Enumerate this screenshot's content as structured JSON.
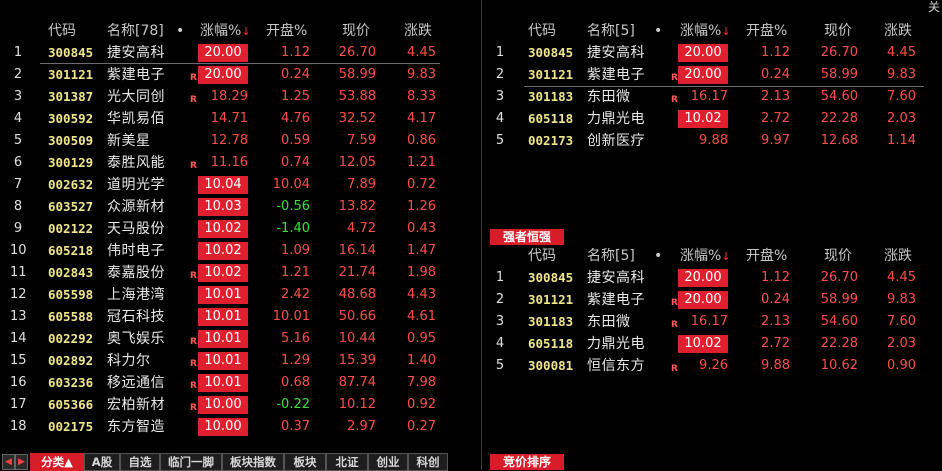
{
  "header": {
    "code": "代码",
    "name_left": "名称[78]",
    "name_right": "名称[5]",
    "dot": "•",
    "change": "涨幅%",
    "sort_arrow": "↓",
    "open": "开盘%",
    "price": "现价",
    "rise": "涨跌"
  },
  "close_label": "关闭",
  "right_top_label": "强者恒强",
  "right_bottom_label": "竞价排序",
  "colors": {
    "accent_red": "#d81c28",
    "code_yellow": "#f0e68c",
    "up_red": "#ff4d4d",
    "down_green": "#3ce03c"
  },
  "left_rows": [
    {
      "idx": "1",
      "code": "300845",
      "name": "捷安高科",
      "r": "",
      "change": "20.00",
      "boxed": true,
      "open": "1.12",
      "open_color": "red",
      "price": "26.70",
      "rise": "4.45"
    },
    {
      "idx": "2",
      "code": "301121",
      "name": "紫建电子",
      "r": "R",
      "change": "20.00",
      "boxed": true,
      "open": "0.24",
      "open_color": "red",
      "price": "58.99",
      "rise": "9.83"
    },
    {
      "idx": "3",
      "code": "301387",
      "name": "光大同创",
      "r": "R",
      "change": "18.29",
      "boxed": false,
      "open": "1.25",
      "open_color": "red",
      "price": "53.88",
      "rise": "8.33"
    },
    {
      "idx": "4",
      "code": "300592",
      "name": "华凯易佰",
      "r": "",
      "change": "14.71",
      "boxed": false,
      "open": "4.76",
      "open_color": "red",
      "price": "32.52",
      "rise": "4.17"
    },
    {
      "idx": "5",
      "code": "300509",
      "name": "新美星",
      "r": "",
      "change": "12.78",
      "boxed": false,
      "open": "0.59",
      "open_color": "red",
      "price": "7.59",
      "rise": "0.86"
    },
    {
      "idx": "6",
      "code": "300129",
      "name": "泰胜风能",
      "r": "R",
      "change": "11.16",
      "boxed": false,
      "open": "0.74",
      "open_color": "red",
      "price": "12.05",
      "rise": "1.21"
    },
    {
      "idx": "7",
      "code": "002632",
      "name": "道明光学",
      "r": "",
      "change": "10.04",
      "boxed": true,
      "open": "10.04",
      "open_color": "red",
      "price": "7.89",
      "rise": "0.72"
    },
    {
      "idx": "8",
      "code": "603527",
      "name": "众源新材",
      "r": "",
      "change": "10.03",
      "boxed": true,
      "open": "-0.56",
      "open_color": "green",
      "price": "13.82",
      "rise": "1.26"
    },
    {
      "idx": "9",
      "code": "002122",
      "name": "天马股份",
      "r": "",
      "change": "10.02",
      "boxed": true,
      "open": "-1.40",
      "open_color": "green",
      "price": "4.72",
      "rise": "0.43"
    },
    {
      "idx": "10",
      "code": "605218",
      "name": "伟时电子",
      "r": "",
      "change": "10.02",
      "boxed": true,
      "open": "1.09",
      "open_color": "red",
      "price": "16.14",
      "rise": "1.47"
    },
    {
      "idx": "11",
      "code": "002843",
      "name": "泰嘉股份",
      "r": "R",
      "change": "10.02",
      "boxed": true,
      "open": "1.21",
      "open_color": "red",
      "price": "21.74",
      "rise": "1.98"
    },
    {
      "idx": "12",
      "code": "605598",
      "name": "上海港湾",
      "r": "",
      "change": "10.01",
      "boxed": true,
      "open": "2.42",
      "open_color": "red",
      "price": "48.68",
      "rise": "4.43"
    },
    {
      "idx": "13",
      "code": "605588",
      "name": "冠石科技",
      "r": "",
      "change": "10.01",
      "boxed": true,
      "open": "10.01",
      "open_color": "red",
      "price": "50.66",
      "rise": "4.61"
    },
    {
      "idx": "14",
      "code": "002292",
      "name": "奥飞娱乐",
      "r": "R",
      "change": "10.01",
      "boxed": true,
      "open": "5.16",
      "open_color": "red",
      "price": "10.44",
      "rise": "0.95"
    },
    {
      "idx": "15",
      "code": "002892",
      "name": "科力尔",
      "r": "R",
      "change": "10.01",
      "boxed": true,
      "open": "1.29",
      "open_color": "red",
      "price": "15.39",
      "rise": "1.40"
    },
    {
      "idx": "16",
      "code": "603236",
      "name": "移远通信",
      "r": "R",
      "change": "10.01",
      "boxed": true,
      "open": "0.68",
      "open_color": "red",
      "price": "87.74",
      "rise": "7.98"
    },
    {
      "idx": "17",
      "code": "605366",
      "name": "宏柏新材",
      "r": "R",
      "change": "10.00",
      "boxed": true,
      "open": "-0.22",
      "open_color": "green",
      "price": "10.12",
      "rise": "0.92"
    },
    {
      "idx": "18",
      "code": "002175",
      "name": "东方智造",
      "r": "",
      "change": "10.00",
      "boxed": true,
      "open": "0.37",
      "open_color": "red",
      "price": "2.97",
      "rise": "0.27"
    }
  ],
  "right_top_rows": [
    {
      "idx": "1",
      "code": "300845",
      "name": "捷安高科",
      "r": "",
      "change": "20.00",
      "boxed": true,
      "open": "1.12",
      "open_color": "red",
      "price": "26.70",
      "rise": "4.45"
    },
    {
      "idx": "2",
      "code": "301121",
      "name": "紫建电子",
      "r": "R",
      "change": "20.00",
      "boxed": true,
      "open": "0.24",
      "open_color": "red",
      "price": "58.99",
      "rise": "9.83"
    },
    {
      "idx": "3",
      "code": "301183",
      "name": "东田微",
      "r": "R",
      "change": "16.17",
      "boxed": false,
      "open": "2.13",
      "open_color": "red",
      "price": "54.60",
      "rise": "7.60"
    },
    {
      "idx": "4",
      "code": "605118",
      "name": "力鼎光电",
      "r": "",
      "change": "10.02",
      "boxed": true,
      "open": "2.72",
      "open_color": "red",
      "price": "22.28",
      "rise": "2.03"
    },
    {
      "idx": "5",
      "code": "002173",
      "name": "创新医疗",
      "r": "",
      "change": "9.88",
      "boxed": false,
      "open": "9.97",
      "open_color": "red",
      "price": "12.68",
      "rise": "1.14"
    }
  ],
  "right_bottom_rows": [
    {
      "idx": "1",
      "code": "300845",
      "name": "捷安高科",
      "r": "",
      "change": "20.00",
      "boxed": true,
      "open": "1.12",
      "open_color": "red",
      "price": "26.70",
      "rise": "4.45"
    },
    {
      "idx": "2",
      "code": "301121",
      "name": "紫建电子",
      "r": "R",
      "change": "20.00",
      "boxed": true,
      "open": "0.24",
      "open_color": "red",
      "price": "58.99",
      "rise": "9.83"
    },
    {
      "idx": "3",
      "code": "301183",
      "name": "东田微",
      "r": "R",
      "change": "16.17",
      "boxed": false,
      "open": "2.13",
      "open_color": "red",
      "price": "54.60",
      "rise": "7.60"
    },
    {
      "idx": "4",
      "code": "605118",
      "name": "力鼎光电",
      "r": "",
      "change": "10.02",
      "boxed": true,
      "open": "2.72",
      "open_color": "red",
      "price": "22.28",
      "rise": "2.03"
    },
    {
      "idx": "5",
      "code": "300081",
      "name": "恒信东方",
      "r": "R",
      "change": "9.26",
      "boxed": false,
      "open": "9.88",
      "open_color": "red",
      "price": "10.62",
      "rise": "0.90"
    }
  ],
  "tabs": [
    {
      "label": "分类▲",
      "active": true,
      "name": "tab-category"
    },
    {
      "label": "A股",
      "active": false,
      "name": "tab-a-shares"
    },
    {
      "label": "自选",
      "active": false,
      "name": "tab-watchlist"
    },
    {
      "label": "临门一脚",
      "active": false,
      "name": "tab-near-limit"
    },
    {
      "label": "板块指数",
      "active": false,
      "name": "tab-sector-index"
    },
    {
      "label": "板块",
      "active": false,
      "name": "tab-sector"
    },
    {
      "label": "北证",
      "active": false,
      "name": "tab-bse"
    },
    {
      "label": "创业",
      "active": false,
      "name": "tab-chinext"
    },
    {
      "label": "科创",
      "active": false,
      "name": "tab-star"
    }
  ],
  "tab_prefix": {
    "A股": "▲"
  }
}
